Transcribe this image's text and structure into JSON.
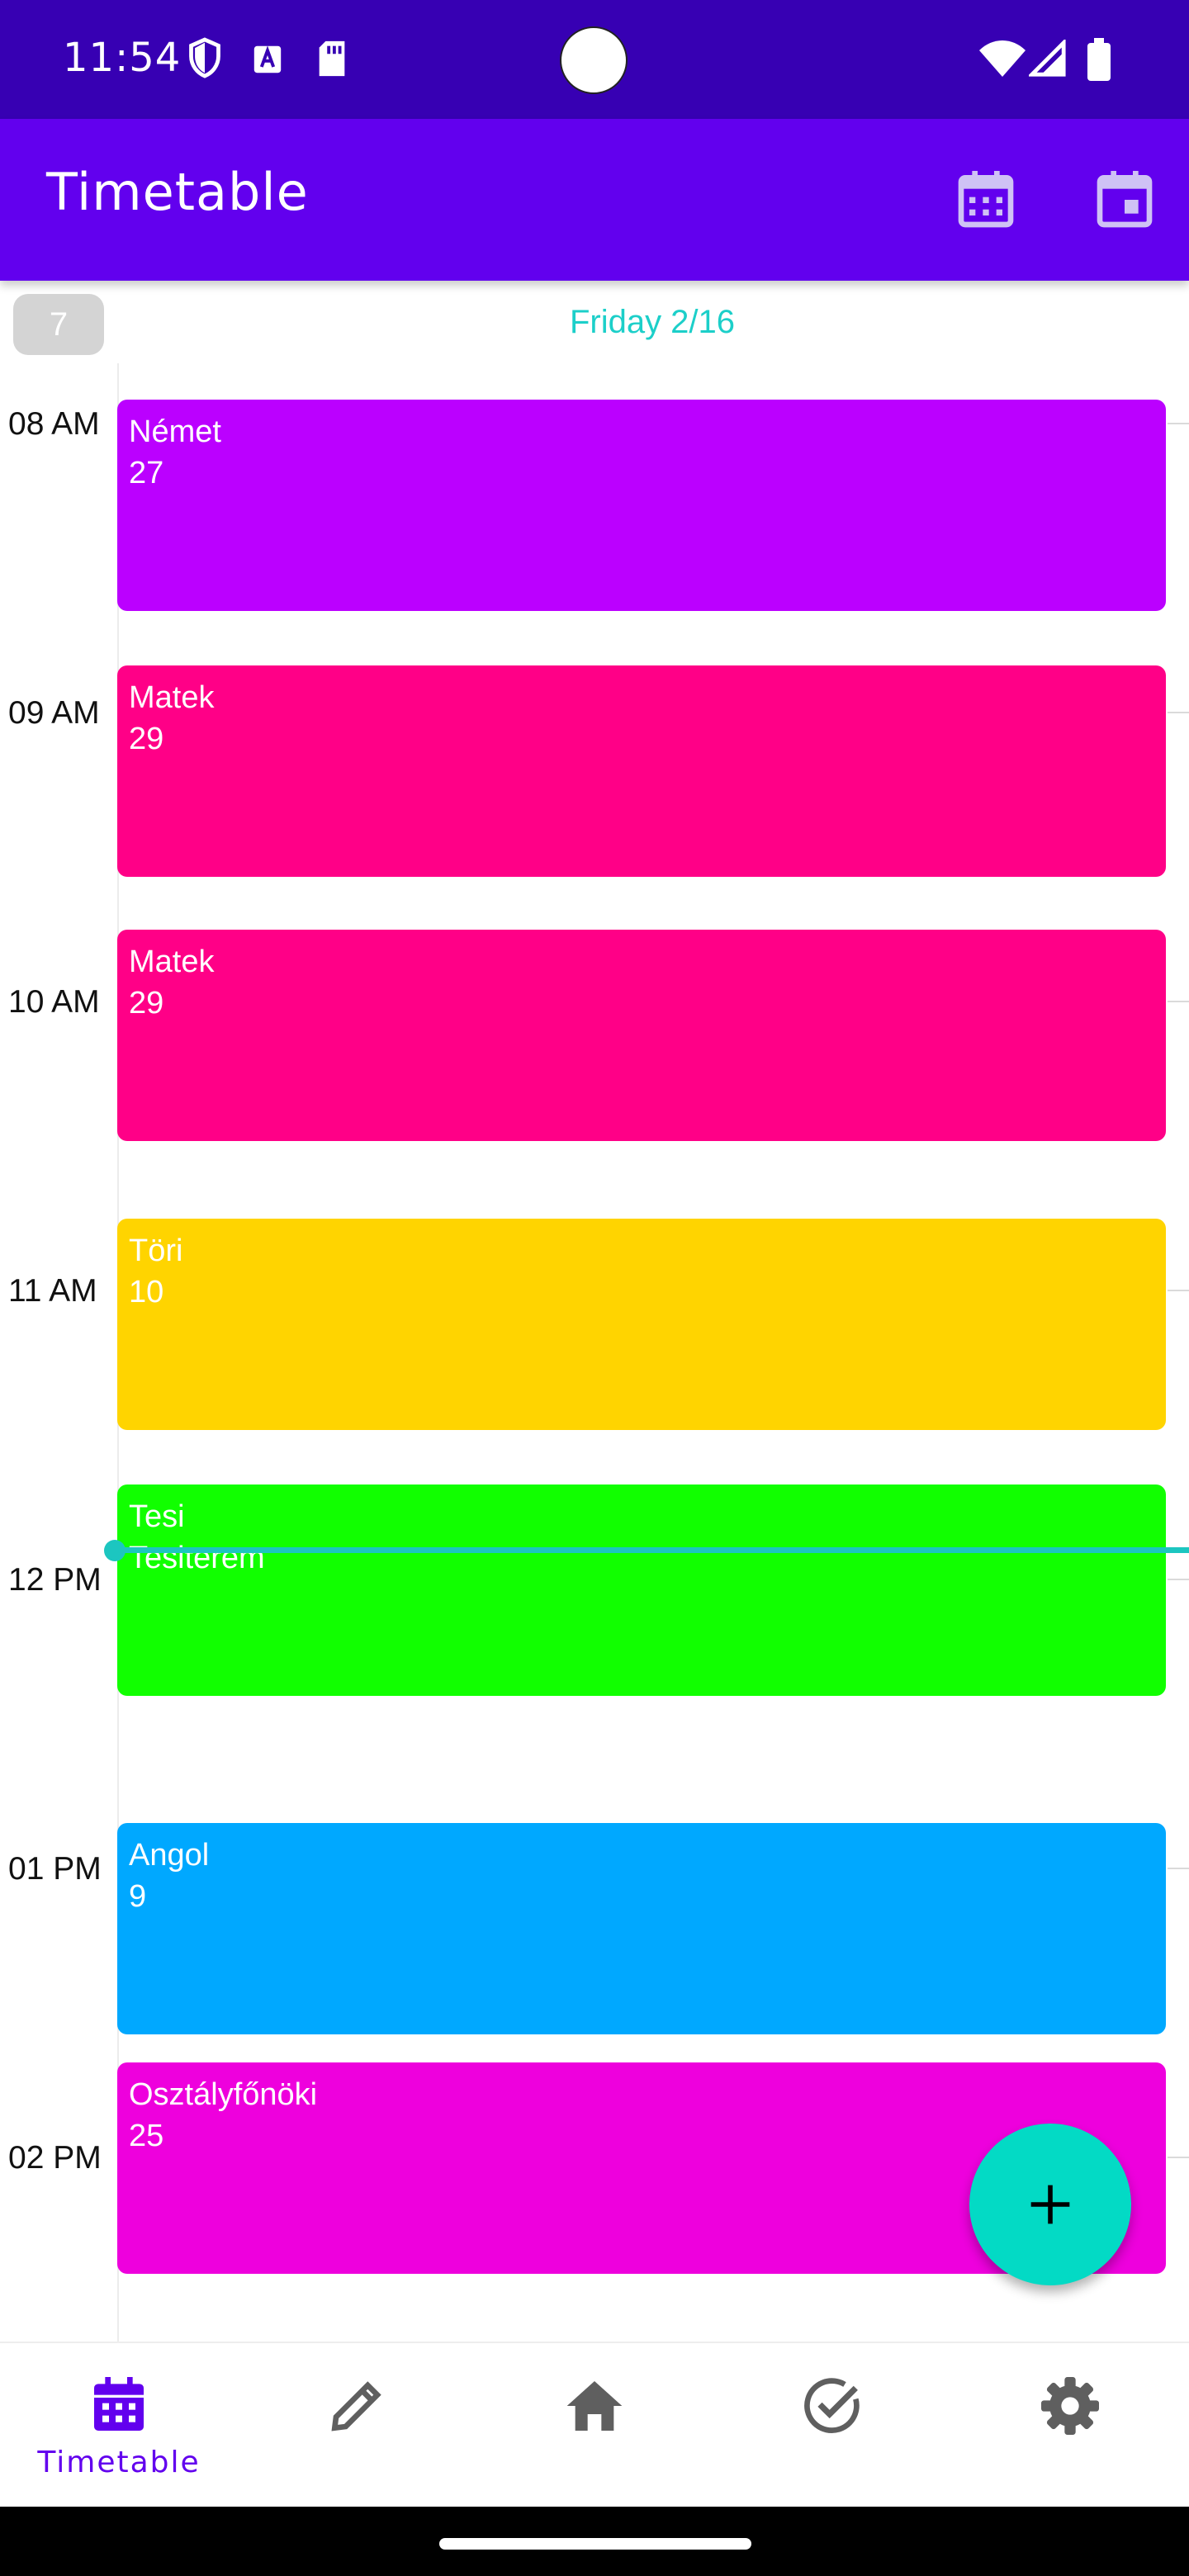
{
  "status_bar": {
    "time": "11:54"
  },
  "app_bar": {
    "title": "Timetable"
  },
  "header": {
    "week_number": "7",
    "day": "Friday 2/16"
  },
  "hours": [
    "08 AM",
    "09 AM",
    "10 AM",
    "11 AM",
    "12 PM",
    "01 PM",
    "02 PM"
  ],
  "events": [
    {
      "subject": "Német",
      "room": "27",
      "color": "#bb00ff"
    },
    {
      "subject": "Matek",
      "room": "29",
      "color": "#ff0087"
    },
    {
      "subject": "Matek",
      "room": "29",
      "color": "#ff0087"
    },
    {
      "subject": "Töri",
      "room": "10",
      "color": "#ffd400"
    },
    {
      "subject": "Tesi",
      "room": "Tesiterem",
      "color": "#11ff00"
    },
    {
      "subject": "Angol",
      "room": "9",
      "color": "#00a8ff"
    },
    {
      "subject": "Osztályfőnöki",
      "room": "25",
      "color": "#ee00dd"
    }
  ],
  "bottom_nav": {
    "items": [
      {
        "label": "Timetable",
        "icon": "calendar-icon",
        "active": true
      },
      {
        "label": "",
        "icon": "pencil-icon",
        "active": false
      },
      {
        "label": "",
        "icon": "home-icon",
        "active": false
      },
      {
        "label": "",
        "icon": "check-circle-icon",
        "active": false
      },
      {
        "label": "",
        "icon": "gear-icon",
        "active": false
      }
    ]
  },
  "colors": {
    "status_bar": "#3700b3",
    "app_bar": "#6200ee",
    "accent": "#03dac5",
    "now_line": "#1cc6c0"
  }
}
